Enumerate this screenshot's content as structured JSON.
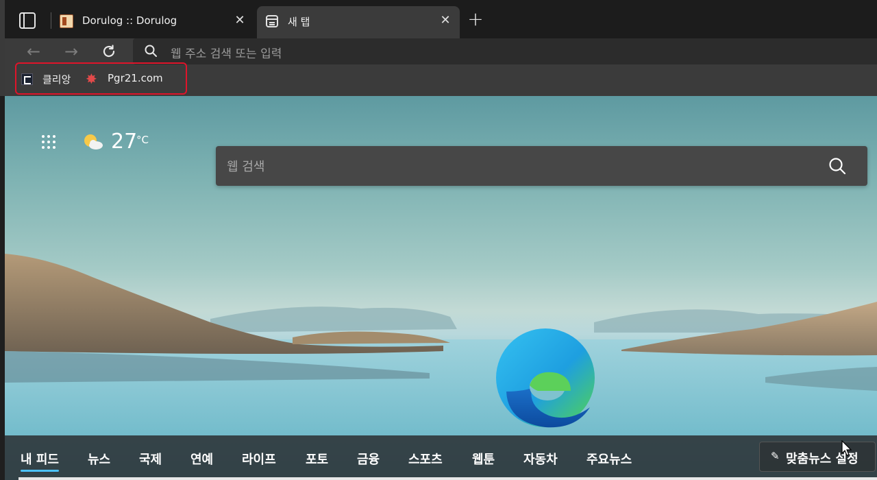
{
  "browser": {
    "tabs": [
      {
        "title": "Dorulog :: Dorulog",
        "close_icon": "close-icon",
        "active": false
      },
      {
        "title": "새 탭",
        "close_icon": "close-icon",
        "active": true
      }
    ],
    "new_tab_icon": "plus-icon",
    "tab_actions_icon": "tab-actions-icon"
  },
  "toolbar": {
    "back_icon": "arrow-left-icon",
    "forward_icon": "arrow-right-icon",
    "refresh_icon": "refresh-icon",
    "address_placeholder": "웹 주소 검색 또는 입력",
    "address_icon": "search-icon"
  },
  "favorites": [
    {
      "label": "클리앙",
      "icon": "clien-favicon"
    },
    {
      "label": "Pgr21.com",
      "icon": "pgr21-favicon"
    }
  ],
  "newtab": {
    "weather": {
      "temperature": "27",
      "unit": "°C",
      "icon": "partly-cloudy-sun-icon"
    },
    "search_placeholder": "웹 검색",
    "search_icon": "search-icon",
    "logo": "microsoft-edge-logo"
  },
  "feed": {
    "items": [
      "내 피드",
      "뉴스",
      "국제",
      "연예",
      "라이프",
      "포토",
      "금융",
      "스포츠",
      "웹툰",
      "자동차",
      "주요뉴스"
    ],
    "active_index": 0,
    "personalize_label": "맞춤뉴스 설정",
    "personalize_icon": "pencil-icon"
  },
  "colors": {
    "accent": "#4cc2ff",
    "highlight_box": "#e0142a",
    "tab_active": "#3b3b3b",
    "tab_strip": "#1c1c1c"
  }
}
